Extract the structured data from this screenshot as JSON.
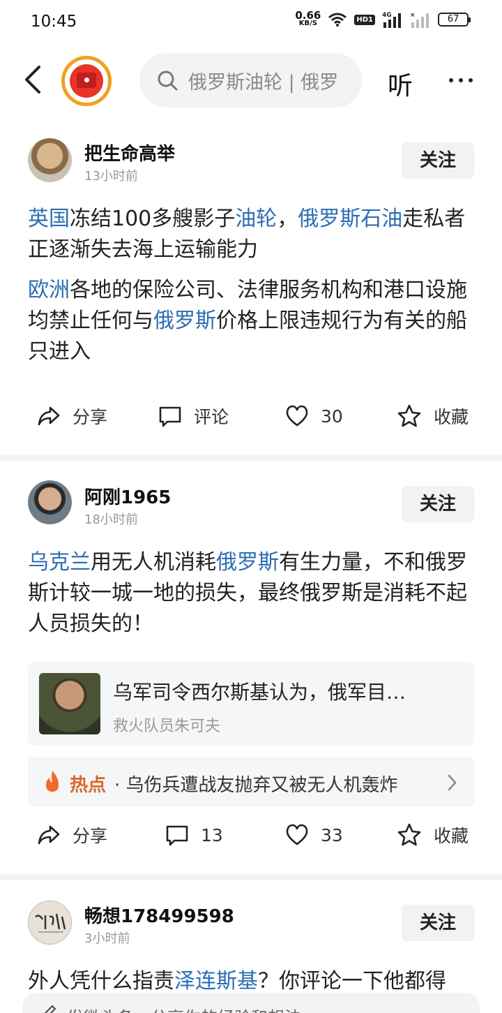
{
  "status_bar": {
    "time": "10:45",
    "net_speed_value": "0.66",
    "net_speed_unit": "KB/S",
    "hd_label": "HD1",
    "signal_label": "4G",
    "battery": "67"
  },
  "nav": {
    "search_text": "俄罗斯油轮 | 俄罗",
    "listen_label": "听"
  },
  "posts": [
    {
      "author": "把生命高举",
      "time": "13小时前",
      "follow_label": "关注",
      "paragraphs": [
        [
          {
            "text": "英国",
            "link": true
          },
          {
            "text": "冻结100多艘影子",
            "link": false
          },
          {
            "text": "油轮",
            "link": true
          },
          {
            "text": "，",
            "link": false
          },
          {
            "text": "俄罗斯石油",
            "link": true
          },
          {
            "text": "走私者正逐渐失去海上运输能力",
            "link": false
          }
        ],
        [
          {
            "text": "欧洲",
            "link": true
          },
          {
            "text": "各地的保险公司、法律服务机构和港口设施均禁止任何与",
            "link": false
          },
          {
            "text": "俄罗斯",
            "link": true
          },
          {
            "text": "价格上限违规行为有关的船只进入",
            "link": false
          }
        ]
      ],
      "actions": {
        "share": "分享",
        "comment": "评论",
        "likes": "30",
        "favorite": "收藏"
      }
    },
    {
      "author": "阿刚1965",
      "time": "18小时前",
      "follow_label": "关注",
      "paragraphs": [
        [
          {
            "text": "乌克兰",
            "link": true
          },
          {
            "text": "用无人机消耗",
            "link": false
          },
          {
            "text": "俄罗斯",
            "link": true
          },
          {
            "text": "有生力量，不和俄罗斯计较一城一地的损失，最终俄罗斯是消耗不起人员损失的！",
            "link": false
          }
        ]
      ],
      "card": {
        "title": "乌军司令西尔斯基认为，俄军目…",
        "source": "救火队员朱可夫"
      },
      "hot": {
        "label": "热点",
        "text": "· 乌伤兵遭战友抛弃又被无人机轰炸"
      },
      "actions": {
        "share": "分享",
        "comment": "13",
        "likes": "33",
        "favorite": "收藏"
      }
    },
    {
      "author": "畅想178499598",
      "time": "3小时前",
      "follow_label": "关注",
      "paragraphs": [
        [
          {
            "text": "外人凭什么指责",
            "link": false
          },
          {
            "text": "泽连斯基",
            "link": true
          },
          {
            "text": "？你评论一下他都得",
            "link": false
          }
        ]
      ]
    }
  ],
  "bottom_bar": {
    "placeholder": "发微头条，分享你的经验和想法"
  },
  "colors": {
    "link": "#2c6db4",
    "hot": "#d8692a",
    "logo_ring": "#f0a020",
    "logo_red": "#e8332a"
  }
}
